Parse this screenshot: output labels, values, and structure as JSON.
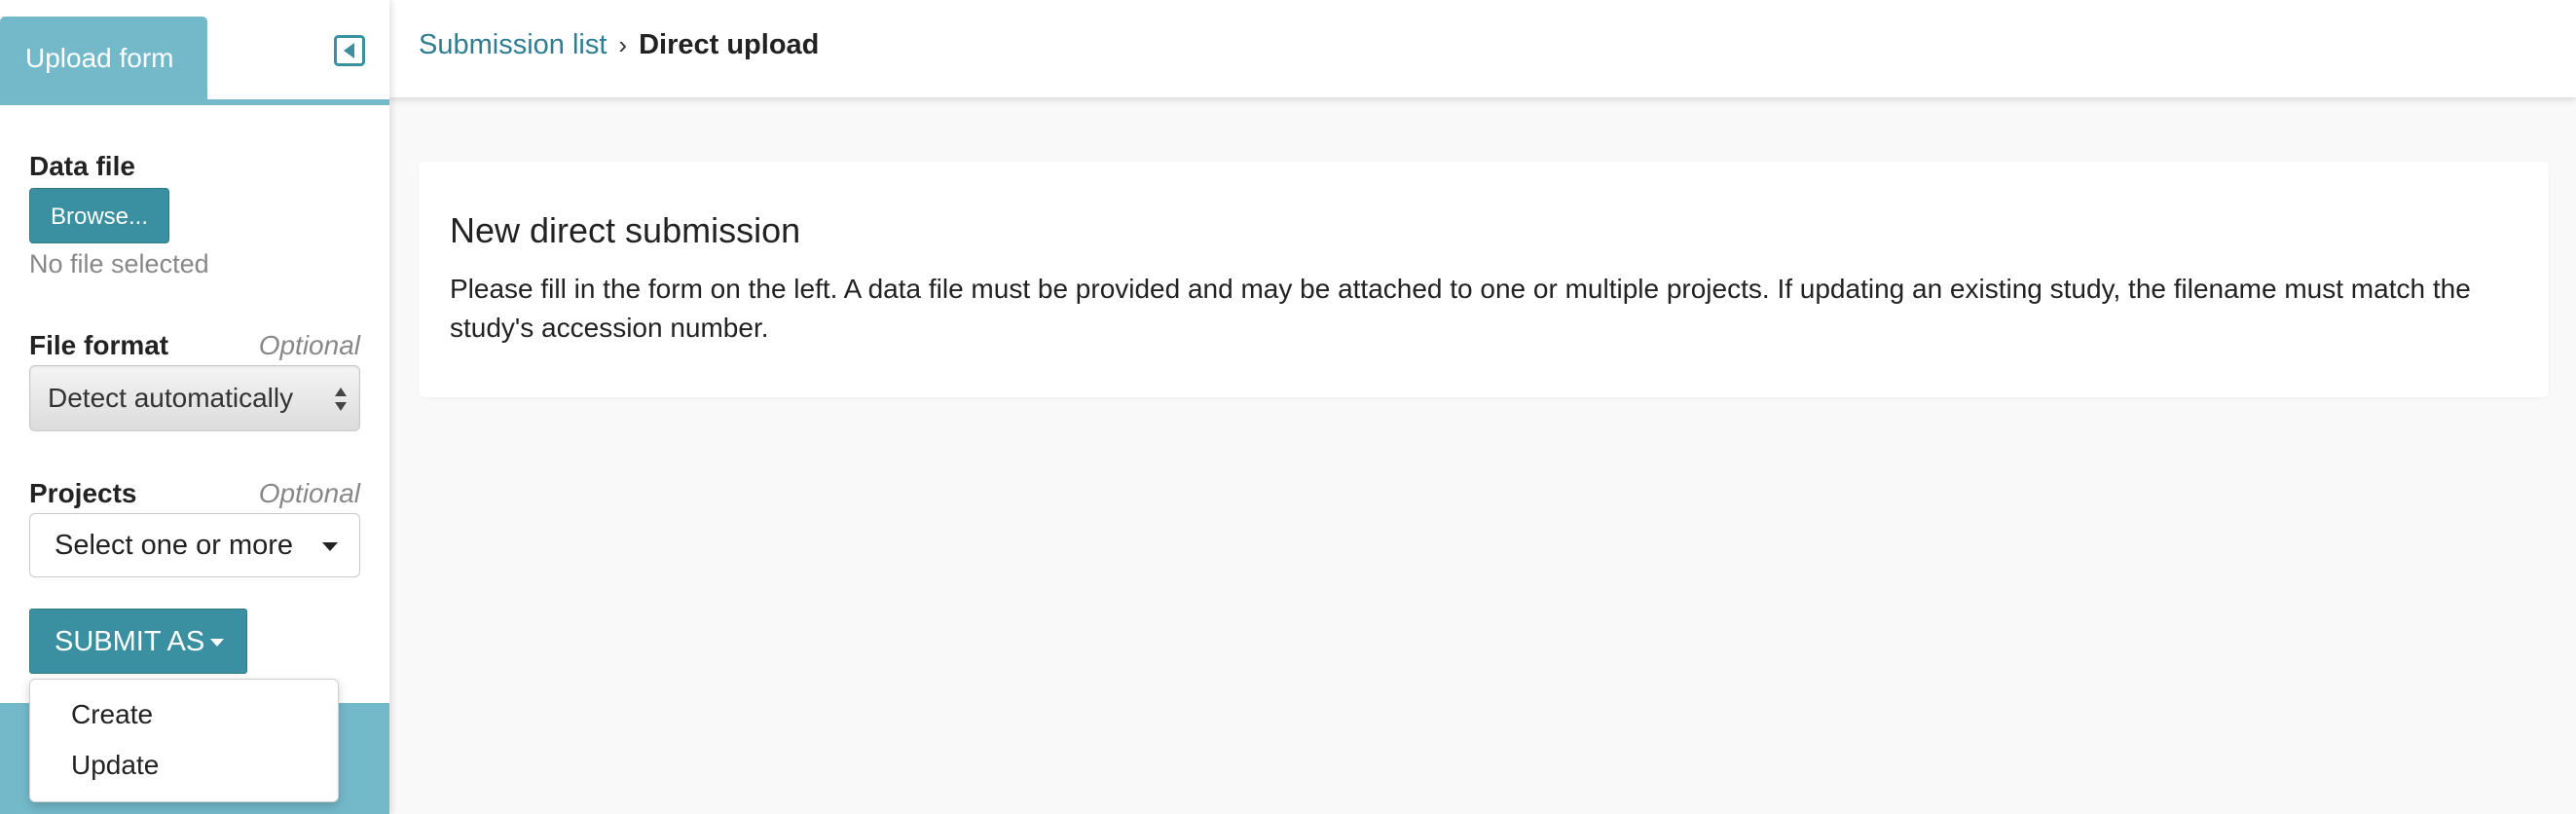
{
  "sidebar": {
    "tab_label": "Upload form",
    "collapse_icon": "collapse-left-icon",
    "data_file": {
      "label": "Data file",
      "browse_label": "Browse...",
      "status": "No file selected"
    },
    "file_format": {
      "label": "File format",
      "optional": "Optional",
      "selected": "Detect automatically"
    },
    "projects": {
      "label": "Projects",
      "optional": "Optional",
      "placeholder": "Select one or more"
    },
    "submit": {
      "label": "SUBMIT AS",
      "menu_items": [
        "Create",
        "Update"
      ]
    }
  },
  "header": {
    "breadcrumb": {
      "parent": "Submission list",
      "current": "Direct upload"
    }
  },
  "main": {
    "title": "New direct submission",
    "description": "Please fill in the form on the left. A data file must be provided and may be attached to one or multiple projects. If updating an existing study, the filename must match the study's accession number."
  },
  "colors": {
    "accent": "#74b9ca",
    "button": "#3a8fa0",
    "link": "#2e7d92",
    "background": "#f9f9f9"
  }
}
